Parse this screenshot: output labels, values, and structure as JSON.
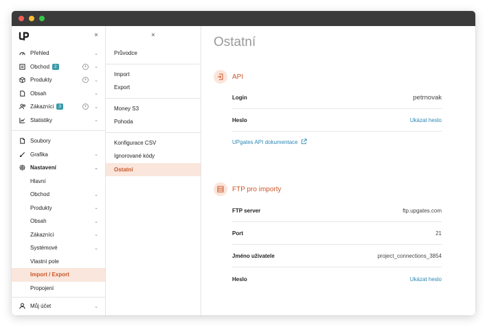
{
  "window": {
    "dots": [
      "#f45e55",
      "#f8bd32",
      "#36c648"
    ]
  },
  "sidebar": {
    "close_label": "×",
    "items": [
      {
        "label": "Přehled",
        "icon": "gauge-icon",
        "chev": true
      },
      {
        "label": "Obchod",
        "icon": "cash-register-icon",
        "badge": "2",
        "plus": true,
        "chev": true
      },
      {
        "label": "Produkty",
        "icon": "box-icon",
        "plus": true,
        "chev": true
      },
      {
        "label": "Obsah",
        "icon": "document-icon",
        "chev": true
      },
      {
        "label": "Zákazníci",
        "icon": "users-icon",
        "badge": "3",
        "plus": true,
        "chev": true
      },
      {
        "label": "Statistiky",
        "icon": "chart-icon",
        "chev": true
      }
    ],
    "items2": [
      {
        "label": "Soubory",
        "icon": "file-icon"
      },
      {
        "label": "Grafika",
        "icon": "palette-icon",
        "chev": true
      },
      {
        "label": "Nastavení",
        "icon": "gear-icon",
        "chev": true
      }
    ],
    "sub": [
      {
        "label": "Hlavní"
      },
      {
        "label": "Obchod",
        "chev": true
      },
      {
        "label": "Produkty",
        "chev": true
      },
      {
        "label": "Obsah",
        "chev": true
      },
      {
        "label": "Zákazníci",
        "chev": true
      },
      {
        "label": "Systémové",
        "chev": true
      },
      {
        "label": "Vlastní pole"
      },
      {
        "label": "Import / Export",
        "active": true
      },
      {
        "label": "Propojení"
      }
    ],
    "account": {
      "label": "Můj účet",
      "icon": "user-icon"
    }
  },
  "middle": {
    "close_label": "×",
    "groups": [
      [
        "Průvodce"
      ],
      [
        "Import",
        "Export"
      ],
      [
        "Money S3",
        "Pohoda"
      ],
      [
        "Konfigurace CSV",
        "Ignorované kódy",
        "Ostatní"
      ]
    ],
    "active": "Ostatní"
  },
  "main": {
    "title": "Ostatní",
    "api": {
      "title": "API",
      "login_label": "Login",
      "login_value": "petrnovak",
      "password_label": "Heslo",
      "password_link": "Ukázat heslo",
      "docs_link": "UPgates API dokumentace"
    },
    "ftp": {
      "title": "FTP pro importy",
      "server_label": "FTP server",
      "server_value": "ftp.upgates.com",
      "port_label": "Port",
      "port_value": "21",
      "user_label": "Jméno uživatele",
      "user_value": "project_connections_3854",
      "password_label": "Heslo",
      "password_link": "Ukázat heslo"
    }
  }
}
